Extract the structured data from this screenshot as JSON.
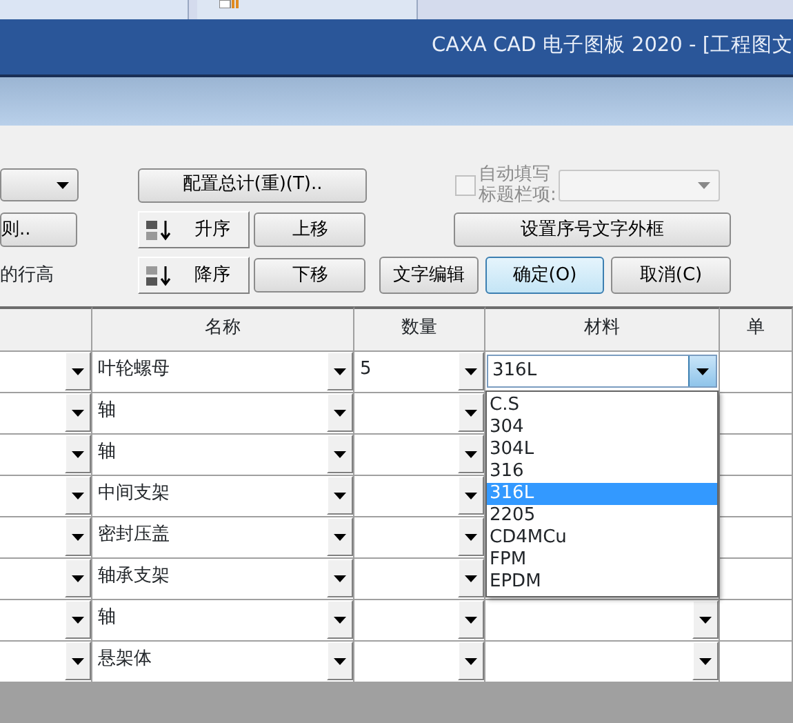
{
  "taskbar": {
    "tabs": [
      {
        "selected": false,
        "icon": false
      },
      {
        "selected": true,
        "icon": true
      }
    ]
  },
  "window": {
    "title": "CAXA CAD 电子图板 2020 - [工程图文"
  },
  "dialog": {
    "rule_button": "则..",
    "row_height_label": "的行高",
    "config_button": "配置总计(重)(T)..",
    "auto_fill": {
      "label": "自动填写标题栏项:",
      "checked": false,
      "disabled": true
    },
    "sort_buttons": [
      {
        "label": "升序",
        "kind": "asc"
      },
      {
        "label": "降序",
        "kind": "desc"
      }
    ],
    "move_buttons": [
      "上移",
      "下移"
    ],
    "frame_button": "设置序号文字外框",
    "action_buttons": [
      {
        "label": "文字编辑",
        "default": false
      },
      {
        "label": "确定(O)",
        "default": true
      },
      {
        "label": "取消(C)",
        "default": false
      }
    ]
  },
  "table": {
    "columns": [
      "名称",
      "数量",
      "材料",
      "单"
    ],
    "rows": [
      {
        "name": "叶轮螺母",
        "quantity": "5",
        "material": "316L",
        "editing": true
      },
      {
        "name": "轴",
        "editing": false
      },
      {
        "name": "轴",
        "editing": false
      },
      {
        "name": "中间支架",
        "editing": false
      },
      {
        "name": "密封压盖",
        "editing": false
      },
      {
        "name": "轴承支架",
        "editing": false
      },
      {
        "name": "轴",
        "editing": false
      },
      {
        "name": "悬架体",
        "editing": false
      }
    ]
  },
  "material_dropdown": {
    "items": [
      {
        "label": "C.S",
        "selected": false
      },
      {
        "label": "304",
        "selected": false
      },
      {
        "label": "304L",
        "selected": false
      },
      {
        "label": "316",
        "selected": false
      },
      {
        "label": "316L",
        "selected": true
      },
      {
        "label": "2205",
        "selected": false
      },
      {
        "label": "CD4MCu",
        "selected": false
      },
      {
        "label": "FPM",
        "selected": false
      },
      {
        "label": "EPDM",
        "selected": false
      }
    ]
  }
}
